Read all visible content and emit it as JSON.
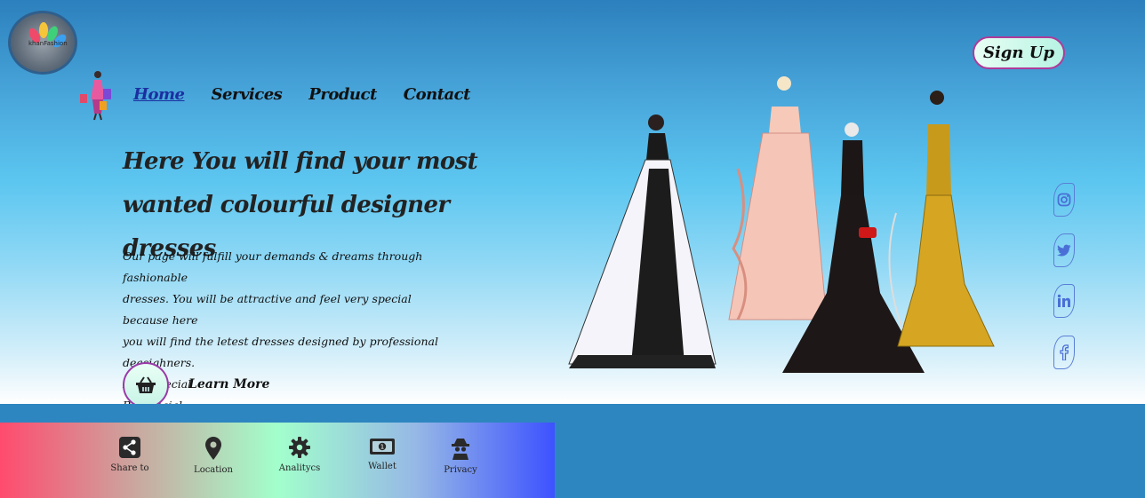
{
  "logo": {
    "brand": "khanFashion"
  },
  "nav": {
    "items": [
      {
        "label": "Home",
        "active": true
      },
      {
        "label": "Services",
        "active": false
      },
      {
        "label": "Product",
        "active": false
      },
      {
        "label": "Contact",
        "active": false
      }
    ]
  },
  "header": {
    "signup_label": "Sign Up"
  },
  "hero": {
    "title": "Here You will find your most wanted colourful designer dresses",
    "desc_lines": [
      "Our page will fulfill your demands & dreams through fashionable",
      "dresses. You will be attractive and feel very special because here",
      "you will find the letest dresses designed by professional deasighners.",
      "Feel Special",
      "Be Special"
    ],
    "learn_more": "Learn More"
  },
  "social": [
    {
      "icon": "instagram-icon"
    },
    {
      "icon": "twitter-icon"
    },
    {
      "icon": "linkedin-icon"
    },
    {
      "icon": "facebook-icon"
    }
  ],
  "bottom_bar": {
    "items": [
      {
        "label": "Share to",
        "icon": "share-icon"
      },
      {
        "label": "Location",
        "icon": "location-pin-icon"
      },
      {
        "label": "Analitycs",
        "icon": "gear-icon"
      },
      {
        "label": "Wallet",
        "icon": "wallet-icon"
      },
      {
        "label": "Privacy",
        "icon": "privacy-icon"
      }
    ]
  },
  "colors": {
    "accent_border": "#b03a9a",
    "social_icon": "#4a6fd6"
  }
}
